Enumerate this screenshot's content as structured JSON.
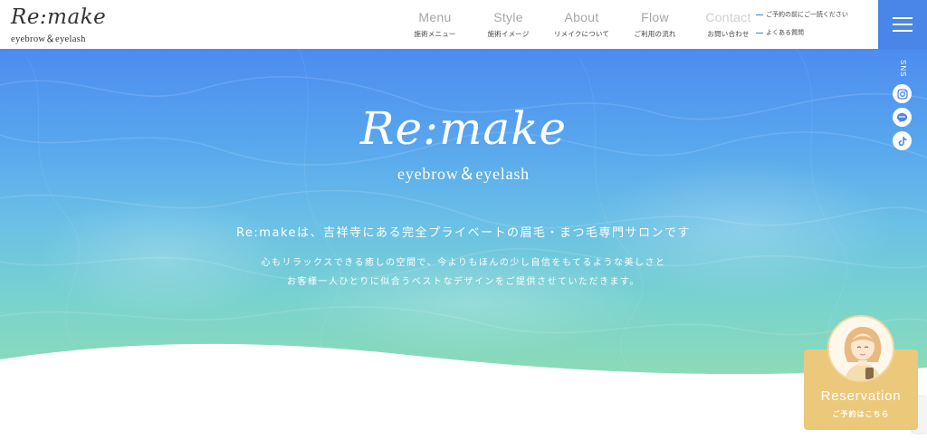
{
  "header": {
    "logo_main": "Re:make",
    "logo_sub": "eyebrow＆eyelash",
    "nav": [
      {
        "en": "Menu",
        "jp": "施術メニュー"
      },
      {
        "en": "Style",
        "jp": "施術イメージ"
      },
      {
        "en": "About",
        "jp": "リメイクについて"
      },
      {
        "en": "Flow",
        "jp": "ご利用の流れ"
      },
      {
        "en": "Contact",
        "jp": "お問い合わせ"
      }
    ],
    "side_links": [
      "ご予約の前にご一読ください",
      "よくある質問"
    ]
  },
  "hero": {
    "logo_main": "Re:make",
    "logo_sub": "eyebrow＆eyelash",
    "tagline": "Re:makeは、吉祥寺にある完全プライベートの眉毛・まつ毛専門サロンです",
    "desc_line1": "心もリラックスできる癒しの空間で、今よりもほんの少し自信をもてるような美しさと",
    "desc_line2": "お客様一人ひとりに似合うベストなデザインをご提供させていただきます。"
  },
  "sns": {
    "label": "SNS",
    "icons": [
      "instagram-icon",
      "line-icon",
      "tiktok-icon"
    ]
  },
  "reservation": {
    "label": "Reservation",
    "sub": "ご予約はこちら"
  },
  "colors": {
    "menu_button": "#4a86e8",
    "hero_top": "#4c8cf0",
    "hero_bottom": "#8fdcb4",
    "reservation_bg": "#ecc87a"
  }
}
